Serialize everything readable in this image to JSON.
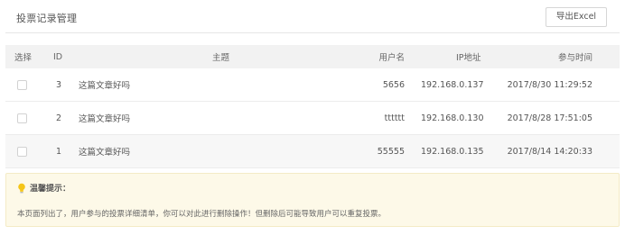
{
  "header": {
    "title": "投票记录管理",
    "export_label": "导出Excel"
  },
  "table": {
    "columns": {
      "select": "选择",
      "id": "ID",
      "topic": "主题",
      "username": "用户名",
      "ip": "IP地址",
      "time": "参与时间"
    },
    "rows": [
      {
        "id": "3",
        "topic": "这篇文章好吗",
        "username": "5656",
        "ip": "192.168.0.137",
        "time": "2017/8/30 11:29:52"
      },
      {
        "id": "2",
        "topic": "这篇文章好吗",
        "username": "tttttt",
        "ip": "192.168.0.130",
        "time": "2017/8/28 17:51:05"
      },
      {
        "id": "1",
        "topic": "这篇文章好吗",
        "username": "55555",
        "ip": "192.168.0.135",
        "time": "2017/8/14 14:20:33"
      }
    ]
  },
  "tip": {
    "icon": "lightbulb-icon",
    "title": "温馨提示：",
    "body": "本页面列出了，用户参与的投票详细清单，你可以对此进行删除操作！但删除后可能导致用户可以重复投票。",
    "icon_color": "#f5c518"
  },
  "colors": {
    "header_bg": "#f2f2f2",
    "hover_row_bg": "#f7f7f7",
    "tip_bg": "#fdf9e8"
  }
}
